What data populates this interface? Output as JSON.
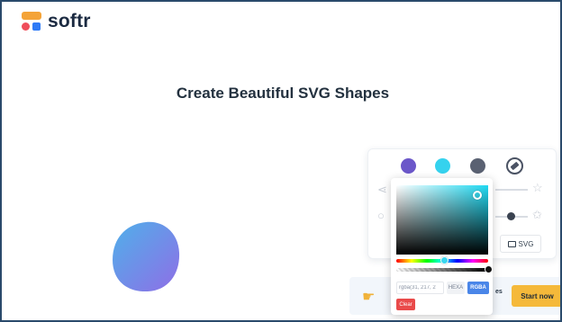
{
  "brand": {
    "name": "softr"
  },
  "hero": {
    "title": "Create Beautiful SVG Shapes"
  },
  "toolbar": {
    "swatches": [
      "#6b57c9",
      "#35d2ee",
      "#5a6172"
    ],
    "svg_button_label": "SVG"
  },
  "color_picker": {
    "hue_color": "#1fd9f2",
    "input_value": "rgba(31, 217, 2",
    "hexa_label": "HEXA",
    "rgba_label": "RGBA",
    "clear_label": "Clear"
  },
  "cta": {
    "partial_text": "es",
    "button_label": "Start now"
  },
  "colors": {
    "blob_gradient_start": "#5ba6e9",
    "blob_gradient_end": "#8d6fe6",
    "accent_yellow": "#f5b93a",
    "rgba_active": "#4a86e8",
    "clear_red": "#e94a4a"
  }
}
